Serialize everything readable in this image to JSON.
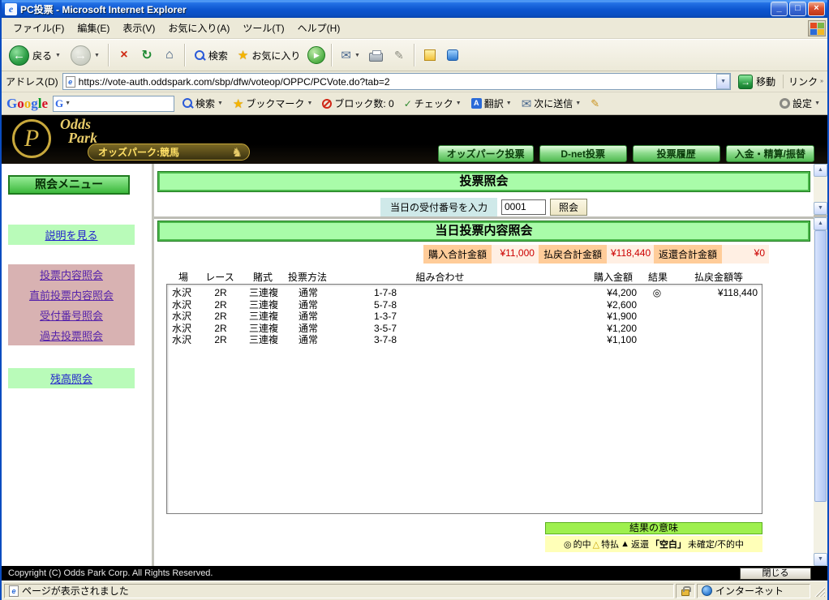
{
  "window": {
    "title": "PC投票 - Microsoft Internet Explorer"
  },
  "menu": {
    "items": [
      "ファイル(F)",
      "編集(E)",
      "表示(V)",
      "お気に入り(A)",
      "ツール(T)",
      "ヘルプ(H)"
    ]
  },
  "toolbar": {
    "back": "戻る",
    "search": "検索",
    "favorites": "お気に入り"
  },
  "address": {
    "label": "アドレス(D)",
    "url": "https://vote-auth.oddspark.com/sbp/dfw/voteop/OPPC/PCVote.do?tab=2",
    "go": "移動",
    "links": "リンク"
  },
  "googlebar": {
    "logo": "Google",
    "search": "検索",
    "bookmarks": "ブックマーク",
    "block_count": "ブロック数: 0",
    "check": "チェック",
    "translate": "翻訳",
    "send": "次に送信",
    "settings": "設定"
  },
  "site": {
    "brand_line1": "Odds",
    "brand_line2": "Park",
    "logo_letter": "P",
    "tagline": "オッズパーク:競馬",
    "nav": [
      "オッズパーク投票",
      "D-net投票",
      "投票履歴",
      "入金・精算/振替"
    ]
  },
  "sidebar": {
    "title": "照会メニュー",
    "items": [
      {
        "label": "説明を見る",
        "style": "green"
      },
      {
        "label": "投票内容照会",
        "style": "pink"
      },
      {
        "label": "直前投票内容照会",
        "style": "pink"
      },
      {
        "label": "受付番号照会",
        "style": "pink"
      },
      {
        "label": "過去投票照会",
        "style": "pink"
      },
      {
        "label": "残高照会",
        "style": "green"
      }
    ]
  },
  "inquiry": {
    "title": "投票照会",
    "input_label": "当日の受付番号を入力",
    "input_value": "0001",
    "button": "照会"
  },
  "results": {
    "title": "当日投票内容照会",
    "summary": [
      {
        "label": "購入合計金額",
        "value": "¥11,000"
      },
      {
        "label": "払戻合計金額",
        "value": "¥118,440"
      },
      {
        "label": "返還合計金額",
        "value": "¥0"
      }
    ],
    "table": {
      "headers": [
        "場",
        "レース",
        "賭式",
        "投票方法",
        "組み合わせ",
        "購入金額",
        "結果",
        "払戻金額等"
      ],
      "rows": [
        [
          "水沢",
          "2R",
          "三連複",
          "通常",
          "1-7-8",
          "¥4,200",
          "◎",
          "¥118,440"
        ],
        [
          "水沢",
          "2R",
          "三連複",
          "通常",
          "5-7-8",
          "¥2,600",
          "",
          ""
        ],
        [
          "水沢",
          "2R",
          "三連複",
          "通常",
          "1-3-7",
          "¥1,900",
          "",
          ""
        ],
        [
          "水沢",
          "2R",
          "三連複",
          "通常",
          "3-5-7",
          "¥1,200",
          "",
          ""
        ],
        [
          "水沢",
          "2R",
          "三連複",
          "通常",
          "3-7-8",
          "¥1,100",
          "",
          ""
        ]
      ]
    },
    "legend": {
      "title": "結果の意味",
      "items": [
        {
          "symbol": "◎",
          "label": "的中"
        },
        {
          "symbol": "△",
          "label": "特払"
        },
        {
          "symbol": "▲",
          "label": "返還"
        },
        {
          "symbol": "「空白」",
          "label": "未確定/不的中"
        }
      ]
    }
  },
  "footer": {
    "copyright": "Copyright (C) Odds Park Corp. All Rights Reserved.",
    "close": "閉じる"
  },
  "status": {
    "message": "ページが表示されました",
    "zone": "インターネット"
  },
  "icons": {
    "back": "←",
    "forward": "→",
    "stop": "×",
    "refresh": "↻",
    "home": "⌂",
    "star": "★",
    "mail": "✉",
    "edit": "✎",
    "check": "✓",
    "play": "▶",
    "dropdown": "▼",
    "go": "→",
    "chevrons": "»",
    "up": "▲",
    "down": "▼",
    "min": "_",
    "max": "□",
    "close": "×",
    "translate_glyph": "A",
    "horse": "♞"
  },
  "colors": {
    "accent_green": "#4CB84C",
    "summary_label_bg": "#FFCC99",
    "value_red": "#CC0000",
    "titlebar_blue": "#0C55CF"
  }
}
